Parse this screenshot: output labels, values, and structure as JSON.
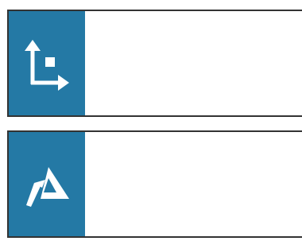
{
  "colors": {
    "panel_blue": "#2479a5",
    "border": "#333333",
    "icon": "#ffffff"
  },
  "cards": [
    {
      "icon": "axes-point-icon",
      "label": ""
    },
    {
      "icon": "mountain-terrain-icon",
      "label": ""
    }
  ]
}
